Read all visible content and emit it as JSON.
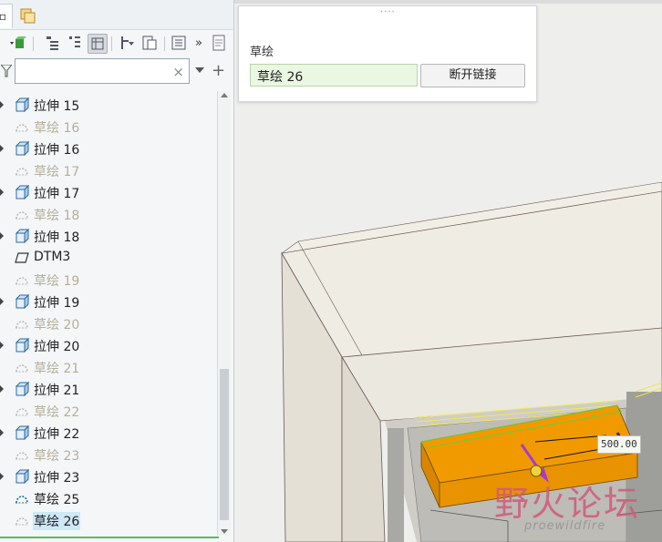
{
  "tabs": [
    {
      "name": "model-tree",
      "label": "▫"
    },
    {
      "name": "layers",
      "label": ""
    }
  ],
  "toolbar": {
    "items": [
      "show-icon",
      "tree-filter-icon",
      "tree-columns-icon",
      "settings-icon",
      "sort-icon",
      "show-all-icon",
      "more-icon",
      "notes-icon"
    ]
  },
  "search": {
    "value": "",
    "clear": "×",
    "add": "+"
  },
  "tree": {
    "items": [
      {
        "label": "拉伸 15",
        "type": "extrude",
        "dim": false
      },
      {
        "label": "草绘 16",
        "type": "sketch",
        "dim": true
      },
      {
        "label": "拉伸 16",
        "type": "extrude",
        "dim": false
      },
      {
        "label": "草绘 17",
        "type": "sketch",
        "dim": true
      },
      {
        "label": "拉伸 17",
        "type": "extrude",
        "dim": false
      },
      {
        "label": "草绘 18",
        "type": "sketch",
        "dim": true
      },
      {
        "label": "拉伸 18",
        "type": "extrude",
        "dim": false
      },
      {
        "label": "DTM3",
        "type": "plane",
        "dim": false
      },
      {
        "label": "草绘 19",
        "type": "sketch",
        "dim": true
      },
      {
        "label": "拉伸 19",
        "type": "extrude",
        "dim": false
      },
      {
        "label": "草绘 20",
        "type": "sketch",
        "dim": true
      },
      {
        "label": "拉伸 20",
        "type": "extrude",
        "dim": false
      },
      {
        "label": "草绘 21",
        "type": "sketch",
        "dim": true
      },
      {
        "label": "拉伸 21",
        "type": "extrude",
        "dim": false
      },
      {
        "label": "草绘 22",
        "type": "sketch",
        "dim": true
      },
      {
        "label": "拉伸 22",
        "type": "extrude",
        "dim": false
      },
      {
        "label": "草绘 23",
        "type": "sketch",
        "dim": true
      },
      {
        "label": "拉伸 23",
        "type": "extrude",
        "dim": false
      },
      {
        "label": "草绘 25",
        "type": "sketch-active",
        "dim": false
      },
      {
        "label": "草绘 26",
        "type": "sketch",
        "dim": false,
        "selected": true
      }
    ]
  },
  "properties": {
    "title": "草绘",
    "field_value": "草绘 26",
    "break_link_label": "断开链接"
  },
  "viewport": {
    "dimension_value": "500.00",
    "watermark_cn": "野火论坛",
    "watermark_en": "proewildfire"
  },
  "colors": {
    "highlight_orange": "#f19a00",
    "selection_blue": "#cde8f7",
    "field_green": "#eaf7e2"
  }
}
